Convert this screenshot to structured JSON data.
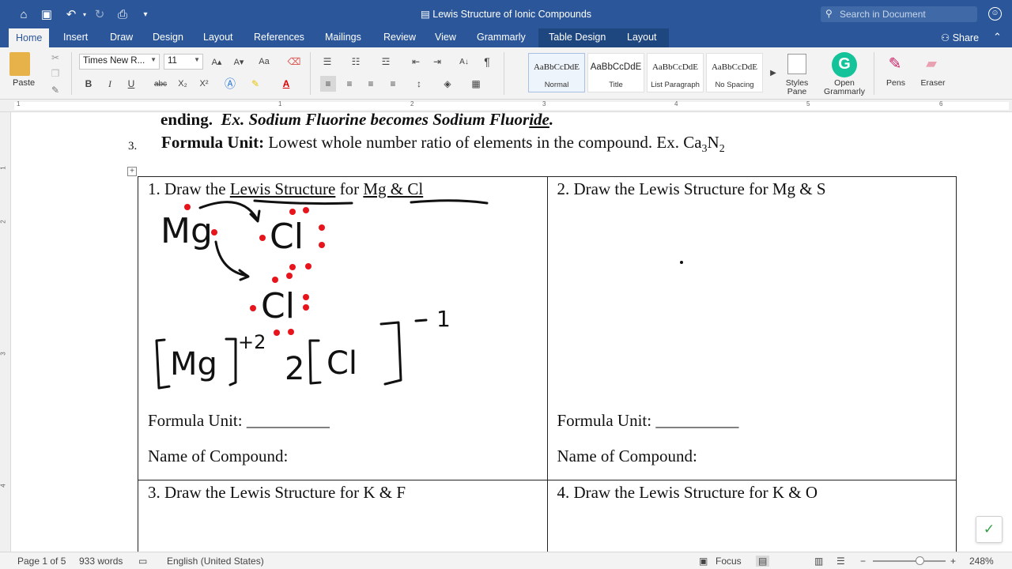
{
  "window": {
    "title": "Lewis Structure of Ionic Compounds"
  },
  "titlebar": {
    "search_placeholder": "Search in Document"
  },
  "tabs": [
    "Home",
    "Insert",
    "Draw",
    "Design",
    "Layout",
    "References",
    "Mailings",
    "Review",
    "View",
    "Grammarly",
    "Table Design",
    "Layout"
  ],
  "share_label": "Share",
  "ribbon": {
    "paste_label": "Paste",
    "font_name": "Times New R...",
    "font_size": "11",
    "bold": "B",
    "italic": "I",
    "underline": "U",
    "strike": "abc",
    "subscript": "X₂",
    "superscript": "X²",
    "styles": [
      {
        "sample": "AaBbCcDdE",
        "label": "Normal"
      },
      {
        "sample": "AaBbCcDdE",
        "label": "Title"
      },
      {
        "sample": "AaBbCcDdE",
        "label": "List Paragraph"
      },
      {
        "sample": "AaBbCcDdE",
        "label": "No Spacing"
      }
    ],
    "styles_pane": "Styles Pane",
    "open_grammarly": "Open Grammarly",
    "pens": "Pens",
    "eraser": "Eraser"
  },
  "ruler": {
    "numbers": [
      "1",
      "1",
      "2",
      "3",
      "4",
      "5",
      "6"
    ]
  },
  "vruler": {
    "numbers": [
      "1",
      "2",
      "3",
      "4"
    ]
  },
  "document": {
    "partial_line_bold": "ending.",
    "partial_line_italic": "Ex.  Sodium Fluorine becomes Sodium Fluor",
    "partial_line_underlined": "ide",
    "partial_line_end": ".",
    "item3_number": "3.",
    "item3_label": "Formula Unit:",
    "item3_text": " Lowest whole number ratio of elements in the compound.  Ex.  Ca",
    "item3_sub1": "3",
    "item3_n": "N",
    "item3_sub2": "2",
    "cells": [
      {
        "title_prefix": "1.  Draw the ",
        "title_ul1": "Lewis Structure",
        "title_mid": " for ",
        "title_ul2": "Mg & Cl",
        "formula": "Formula Unit: __________",
        "name": "Name of Compound:"
      },
      {
        "title": "2.  Draw the Lewis Structure for Mg & S",
        "formula": "Formula Unit: __________",
        "name": "Name of Compound:"
      },
      {
        "title": "3.  Draw the Lewis Structure for K & F"
      },
      {
        "title": "4. Draw the Lewis Structure for K & O"
      }
    ],
    "handwriting": {
      "mg": "Mg",
      "cl": "Cl",
      "bracket_mg": "[Mg]",
      "charge_mg": "+2",
      "coef": "2",
      "bracket_cl": "[Cl]",
      "charge_cl": "-1"
    }
  },
  "statusbar": {
    "page": "Page 1 of 5",
    "words": "933 words",
    "language": "English (United States)",
    "focus": "Focus",
    "zoom": "248%"
  },
  "colors": {
    "accent": "#2b579a",
    "ink_black": "#111111",
    "ink_red": "#e8141b",
    "grammarly": "#15c39a"
  }
}
